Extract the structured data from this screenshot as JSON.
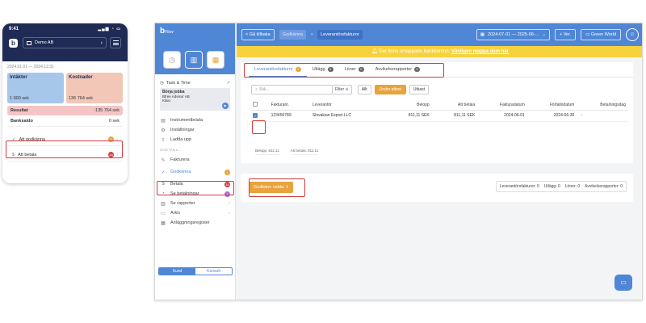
{
  "phone": {
    "time": "9:41",
    "status_icons": "▂▄▆ ◔ ▭",
    "logo": "b",
    "company": "Demo AB",
    "period": "2024.01.01 — 2024.12.31",
    "income_label": "Intäkter",
    "income_value": "1 000 sek",
    "cost_label": "Kostnader",
    "cost_value": "136 764 sek",
    "result_label": "Resultat",
    "result_value": "-135 764 sek",
    "bank_label": "Banksaldo",
    "bank_value": "0 sek",
    "rows": [
      {
        "label": "Att godkänna",
        "badge": "1",
        "badge_color": "#e8a33d"
      },
      {
        "label": "Att betala",
        "badge": "16",
        "badge_color": "#d23b3b"
      }
    ]
  },
  "sidebar": {
    "logo": "b",
    "logo_sub": "Flow",
    "task_title": "Task & Time",
    "task_name": "Börja jobba",
    "task_company": "Bfree Advisor AB",
    "task_status": "Klaio",
    "nav_top": [
      {
        "label": "Instrumentbräda",
        "icon": "▤"
      },
      {
        "label": "Inställningar",
        "icon": "⚙"
      },
      {
        "label": "Ladda upp",
        "icon": "⇪"
      }
    ],
    "section_label": "JAG VILL...",
    "nav_main": [
      {
        "label": "Fakturera",
        "icon": "✎",
        "badge": "",
        "arrow": ""
      },
      {
        "label": "Godkänna",
        "icon": "✓",
        "badge": "1",
        "arrow": "",
        "active": true
      },
      {
        "label": "Betala",
        "icon": "$",
        "badge": "16",
        "arrow": ""
      },
      {
        "label": "Se betalningar",
        "icon": "◔",
        "badge": "4",
        "arrow": ""
      },
      {
        "label": "Se rapporter",
        "icon": "▥",
        "badge": "",
        "arrow": "›"
      },
      {
        "label": "Arkiv",
        "icon": "▭",
        "badge": "",
        "arrow": "›"
      },
      {
        "label": "Anläggningsregister",
        "icon": "▦",
        "badge": "",
        "arrow": ""
      }
    ],
    "toggle_on": "Kund",
    "toggle_off": "Konsult"
  },
  "topbar": {
    "back": "< Gå tillbaka",
    "crumb1": "Godkänna",
    "crumb_sep": "›",
    "crumb2": "Leverantörsfakturor",
    "date_range": "2024-07-01 — 2025-06-...",
    "version_btn": "+ Ver.",
    "company_btn": "Green World",
    "warning": "Det finns omappade bankkonton.",
    "warning_link": "Vänligen mappa dem här"
  },
  "tabs": [
    {
      "label": "Leverantörsfakturor",
      "count": "1",
      "active": true
    },
    {
      "label": "Utlägg",
      "count": "0"
    },
    {
      "label": "Löner",
      "count": "0"
    },
    {
      "label": "Avvikelserapporter",
      "count": "0"
    }
  ],
  "filters": {
    "search_placeholder": "Sök...",
    "filter_label": "Filter",
    "all": "Allt",
    "under_review": "Under attest",
    "draft": "Utkast"
  },
  "table": {
    "headers": [
      "Fakturanr.",
      "Leverantör",
      "Belopp",
      "Att betala",
      "Fakturadatum",
      "Förfallodatum",
      "Betalningsdag"
    ],
    "rows": [
      {
        "invoice": "123456789",
        "supplier": "Slovakian Export LLC",
        "amount": "811,11 SEK",
        "to_pay": "811,11 SEK",
        "inv_date": "2024-06-01",
        "due_date": "2024-06-30",
        "pay_day": "-"
      }
    ],
    "total_amount": "Belopp:  811,11",
    "total_to_pay": "Att betala:  811,11"
  },
  "bottom": {
    "approve_btn": "Godkänn valda: 1",
    "summary": [
      "Leverantörsfakturor: 0",
      "Utlägg: 0",
      "Löner: 0",
      "Avvikelserapporter: 0"
    ]
  },
  "chat_icon": "chat-bubble-icon"
}
